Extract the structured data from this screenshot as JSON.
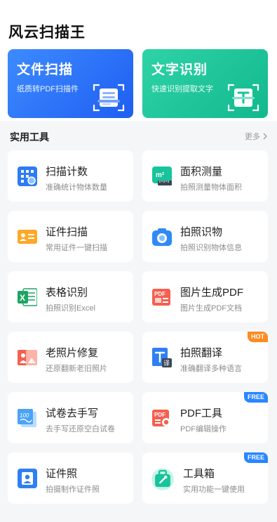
{
  "app": {
    "title": "风云扫描王"
  },
  "hero": [
    {
      "title": "文件扫描",
      "subtitle": "纸质转PDF扫描件",
      "color": "#2f6df6",
      "icon": "document-scan-icon"
    },
    {
      "title": "文字识别",
      "subtitle": "快速识别提取文字",
      "color": "#16c39a",
      "icon": "text-recognition-icon"
    }
  ],
  "section": {
    "title": "实用工具",
    "more_label": "更多"
  },
  "tools": [
    {
      "title": "扫描计数",
      "subtitle": "准确统计物体数量",
      "icon": "count-grid-icon",
      "badge": ""
    },
    {
      "title": "面积测量",
      "subtitle": "拍照测量物体面积",
      "icon": "area-ruler-icon",
      "badge": ""
    },
    {
      "title": "证件扫描",
      "subtitle": "常用证件一键扫描",
      "icon": "id-card-icon",
      "badge": ""
    },
    {
      "title": "拍照识物",
      "subtitle": "拍照识别物体信息",
      "icon": "camera-icon",
      "badge": ""
    },
    {
      "title": "表格识别",
      "subtitle": "拍照识别Excel",
      "icon": "excel-icon",
      "badge": ""
    },
    {
      "title": "图片生成PDF",
      "subtitle": "图片生成PDF文档",
      "icon": "pdf-image-icon",
      "badge": ""
    },
    {
      "title": "老照片修复",
      "subtitle": "还原翻新老旧照片",
      "icon": "photo-restore-icon",
      "badge": ""
    },
    {
      "title": "拍照翻译",
      "subtitle": "准确翻译多种语言",
      "icon": "translate-icon",
      "badge": "HOT"
    },
    {
      "title": "试卷去手写",
      "subtitle": "去手写还原空白试卷",
      "icon": "exam-paper-icon",
      "badge": ""
    },
    {
      "title": "PDF工具",
      "subtitle": "PDF编辑操作",
      "icon": "pdf-tools-icon",
      "badge": "FREE"
    },
    {
      "title": "证件照",
      "subtitle": "拍摄制作证件照",
      "icon": "id-photo-icon",
      "badge": ""
    },
    {
      "title": "工具箱",
      "subtitle": "实用功能一键使用",
      "icon": "toolbox-icon",
      "badge": "FREE"
    }
  ],
  "colors": {
    "hot": "#ff8a1f",
    "free": "#2a86ff",
    "scan_blue": "#2f6df6",
    "ocr_green": "#16c39a"
  }
}
